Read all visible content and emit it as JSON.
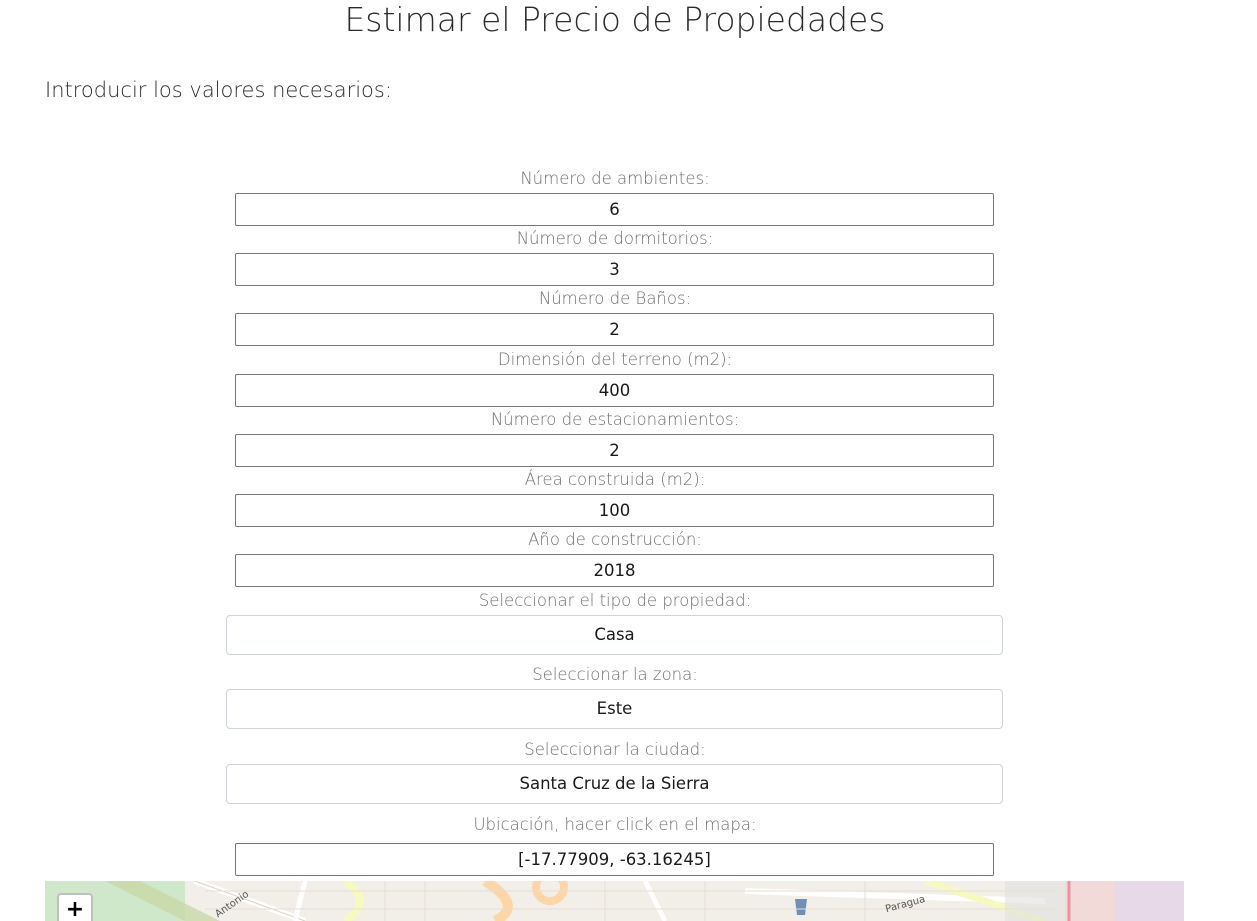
{
  "page": {
    "title": "Estimar el Precio de Propiedades",
    "intro": "Introducir los valores necesarios:"
  },
  "form": {
    "ambientes": {
      "label": "Número de ambientes:",
      "value": "6"
    },
    "dormitorios": {
      "label": "Número de dormitorios:",
      "value": "3"
    },
    "banos": {
      "label": "Número de Baños:",
      "value": "2"
    },
    "terreno": {
      "label": "Dimensión del terreno (m2):",
      "value": "400"
    },
    "estacionamientos": {
      "label": "Número de estacionamientos:",
      "value": "2"
    },
    "area": {
      "label": "Área construida (m2):",
      "value": "100"
    },
    "anio": {
      "label": "Año de construcción:",
      "value": "2018"
    },
    "tipo": {
      "label": "Seleccionar el tipo de propiedad:",
      "value": "Casa"
    },
    "zona": {
      "label": "Seleccionar la zona:",
      "value": "Este"
    },
    "ciudad": {
      "label": "Seleccionar la ciudad:",
      "value": "Santa Cruz de la Sierra"
    },
    "ubicacion": {
      "label": "Ubicación, hacer click en el mapa:",
      "value": "[-17.77909, -63.16245]"
    }
  },
  "map": {
    "zoom_in_label": "+",
    "street_labels": [
      "Antonio",
      "Paragua"
    ]
  }
}
